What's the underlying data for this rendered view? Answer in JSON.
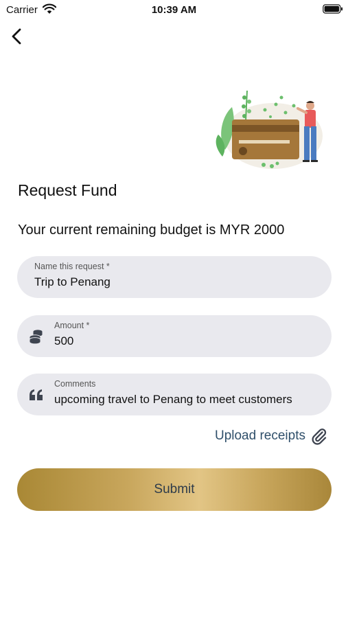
{
  "status_bar": {
    "carrier": "Carrier",
    "time": "10:39 AM"
  },
  "header": {
    "back_icon": "chevron-left-icon"
  },
  "page": {
    "title": "Request Fund",
    "budget_text": "Your current remaining budget is MYR 2000"
  },
  "form": {
    "name": {
      "label": "Name this request *",
      "value": "Trip to Penang"
    },
    "amount": {
      "label": "Amount *",
      "value": "500",
      "icon": "coins-icon"
    },
    "comments": {
      "label": "Comments",
      "value": "upcoming travel to Penang to meet customers",
      "icon": "quote-icon"
    }
  },
  "upload": {
    "label": "Upload receipts",
    "icon": "paperclip-icon"
  },
  "submit": {
    "label": "Submit"
  },
  "colors": {
    "field_bg": "#e9e9ee",
    "link": "#2f4f6a",
    "button_gold": "#c8a65c"
  }
}
